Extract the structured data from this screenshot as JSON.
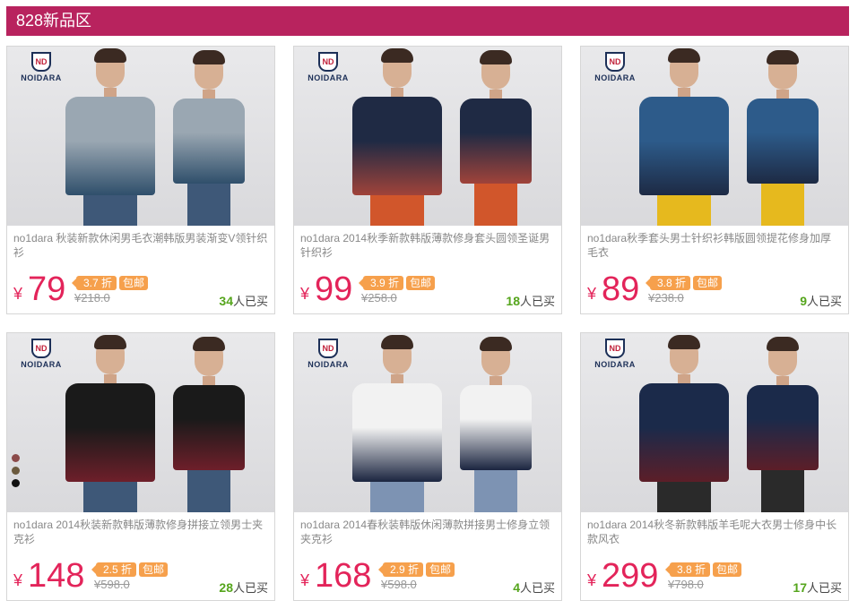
{
  "header": {
    "title": "828新品区"
  },
  "brand": "NOIDARA",
  "products": [
    {
      "title": "no1dara 秋装新款休闲男毛衣潮韩版男装渐变V领针织衫",
      "yen": "¥",
      "price": "79",
      "discount": "3.7 折",
      "free_shipping": "包邮",
      "original": "¥218.0",
      "sold_count": "34",
      "sold_suffix": "人已买",
      "colors": {
        "top": "#9aa7b2",
        "bottom": "#2f4f6b",
        "legs": "#3e5878"
      }
    },
    {
      "title": "no1dara 2014秋季新款韩版薄款修身套头圆领圣诞男针织衫",
      "yen": "¥",
      "price": "99",
      "discount": "3.9 折",
      "free_shipping": "包邮",
      "original": "¥258.0",
      "sold_count": "18",
      "sold_suffix": "人已买",
      "colors": {
        "top": "#1f2a44",
        "bottom": "#a0433a",
        "legs": "#d1562b"
      }
    },
    {
      "title": "no1dara秋季套头男士针织衫韩版圆领提花修身加厚毛衣",
      "yen": "¥",
      "price": "89",
      "discount": "3.8 折",
      "free_shipping": "包邮",
      "original": "¥238.0",
      "sold_count": "9",
      "sold_suffix": "人已买",
      "colors": {
        "top": "#2d5b8a",
        "bottom": "#1d2a44",
        "legs": "#e6b91e"
      }
    },
    {
      "title": "no1dara 2014秋装新款韩版薄款修身拼接立领男士夹克衫",
      "yen": "¥",
      "price": "148",
      "discount": "2.5 折",
      "free_shipping": "包邮",
      "original": "¥598.0",
      "sold_count": "28",
      "sold_suffix": "人已买",
      "colors": {
        "top": "#1a1a1a",
        "bottom": "#6e1f2a",
        "legs": "#3e5878"
      },
      "swatches": [
        "#8b4a4a",
        "#6b5a3e",
        "#111111"
      ]
    },
    {
      "title": "no1dara 2014春秋装韩版休闲薄款拼接男士修身立领夹克衫",
      "yen": "¥",
      "price": "168",
      "discount": "2.9 折",
      "free_shipping": "包邮",
      "original": "¥598.0",
      "sold_count": "4",
      "sold_suffix": "人已买",
      "colors": {
        "top": "#f2f2f2",
        "bottom": "#1b2540",
        "legs": "#7d93b3"
      }
    },
    {
      "title": "no1dara 2014秋冬新款韩版羊毛呢大衣男士修身中长款风衣",
      "yen": "¥",
      "price": "299",
      "discount": "3.8 折",
      "free_shipping": "包邮",
      "original": "¥798.0",
      "sold_count": "17",
      "sold_suffix": "人已买",
      "colors": {
        "top": "#1b2a4a",
        "bottom": "#5c1e28",
        "legs": "#2a2a2a"
      }
    }
  ]
}
